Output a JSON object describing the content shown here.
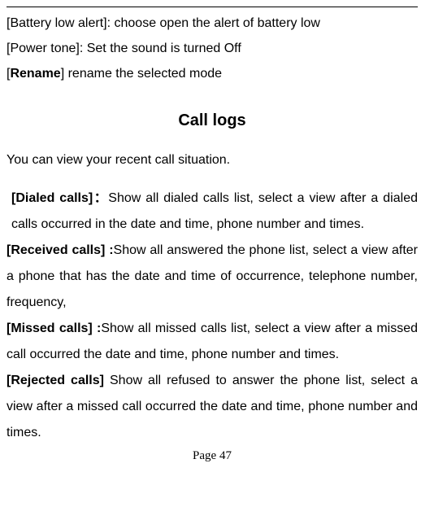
{
  "options": {
    "battery_low": {
      "label": "[Battery low alert]:",
      "desc": "   choose open the alert of battery low"
    },
    "power_tone": {
      "label": "[Power tone]:",
      "desc": " Set the sound is turned Off"
    },
    "rename": {
      "open_bracket": "[",
      "name": "Rename",
      "close_bracket": "]",
      "desc": " rename the selected mode"
    }
  },
  "heading": "Call logs",
  "intro": "You can view your recent call situation.",
  "sections": {
    "dialed": {
      "label": "[Dialed calls]：",
      "text": "Show all dialed calls list, select a view after a dialed calls occurred in the date and time, phone number and times."
    },
    "received": {
      "label": "[Received calls] :",
      "text": "Show all answered the phone list, select a view after a phone that has the date and time of occurrence, telephone number, frequency,"
    },
    "missed": {
      "label": "[Missed calls] :",
      "text": "Show all missed calls list, select a view after a missed call occurred the date and time, phone number and times."
    },
    "rejected": {
      "label": "[Rejected calls] ",
      "text": "Show all refused to answer the phone list, select a view after a missed call occurred the date and time, phone number and times."
    }
  },
  "footer": "Page 47"
}
